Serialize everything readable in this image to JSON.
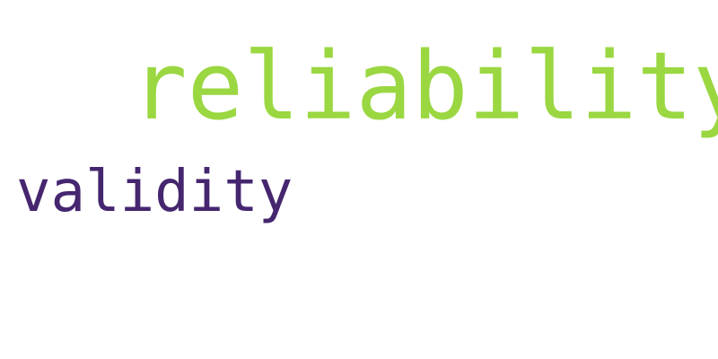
{
  "words": [
    {
      "text": "reliability",
      "color": "#9ad741"
    },
    {
      "text": "validity",
      "color": "#45266f"
    }
  ]
}
